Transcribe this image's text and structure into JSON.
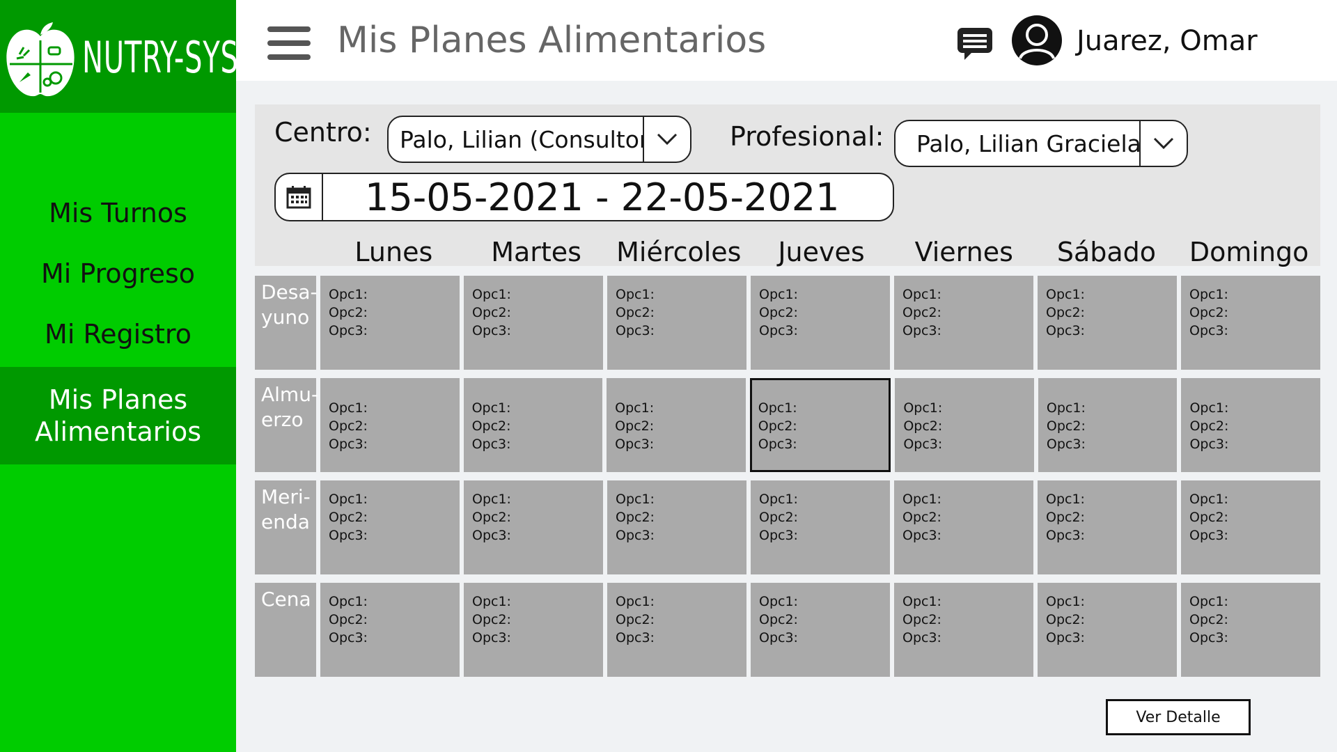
{
  "app": {
    "name": "NUTRY-SYS"
  },
  "sidebar": {
    "items": [
      {
        "label": "Mis Turnos"
      },
      {
        "label": "Mi Progreso"
      },
      {
        "label": "Mi Registro"
      },
      {
        "label": "Mis Planes Alimentarios",
        "active": true
      }
    ]
  },
  "header": {
    "title": "Mis Planes Alimentarios",
    "user_name": "Juarez, Omar"
  },
  "filters": {
    "centro_label": "Centro:",
    "centro_value": "Palo, Lilian (Consultorio)",
    "profesional_label": "Profesional:",
    "profesional_value": "Palo, Lilian Graciela",
    "date_range": "15-05-2021 - 22-05-2021"
  },
  "days": [
    "Lunes",
    "Martes",
    "Miércoles",
    "Jueves",
    "Viernes",
    "Sábado",
    "Domingo"
  ],
  "meals": [
    {
      "label": "Desa-\nyuno"
    },
    {
      "label": "Almu-\nerzo"
    },
    {
      "label": "Meri-\nenda"
    },
    {
      "label": "Cena"
    }
  ],
  "options": [
    "Opc1:",
    "Opc2:",
    "Opc3:"
  ],
  "actions": {
    "detail_button": "Ver Detalle"
  },
  "colors": {
    "sidebar": "#00cc00",
    "sidebar_dark": "#009900",
    "cell": "#aaaaaa"
  }
}
